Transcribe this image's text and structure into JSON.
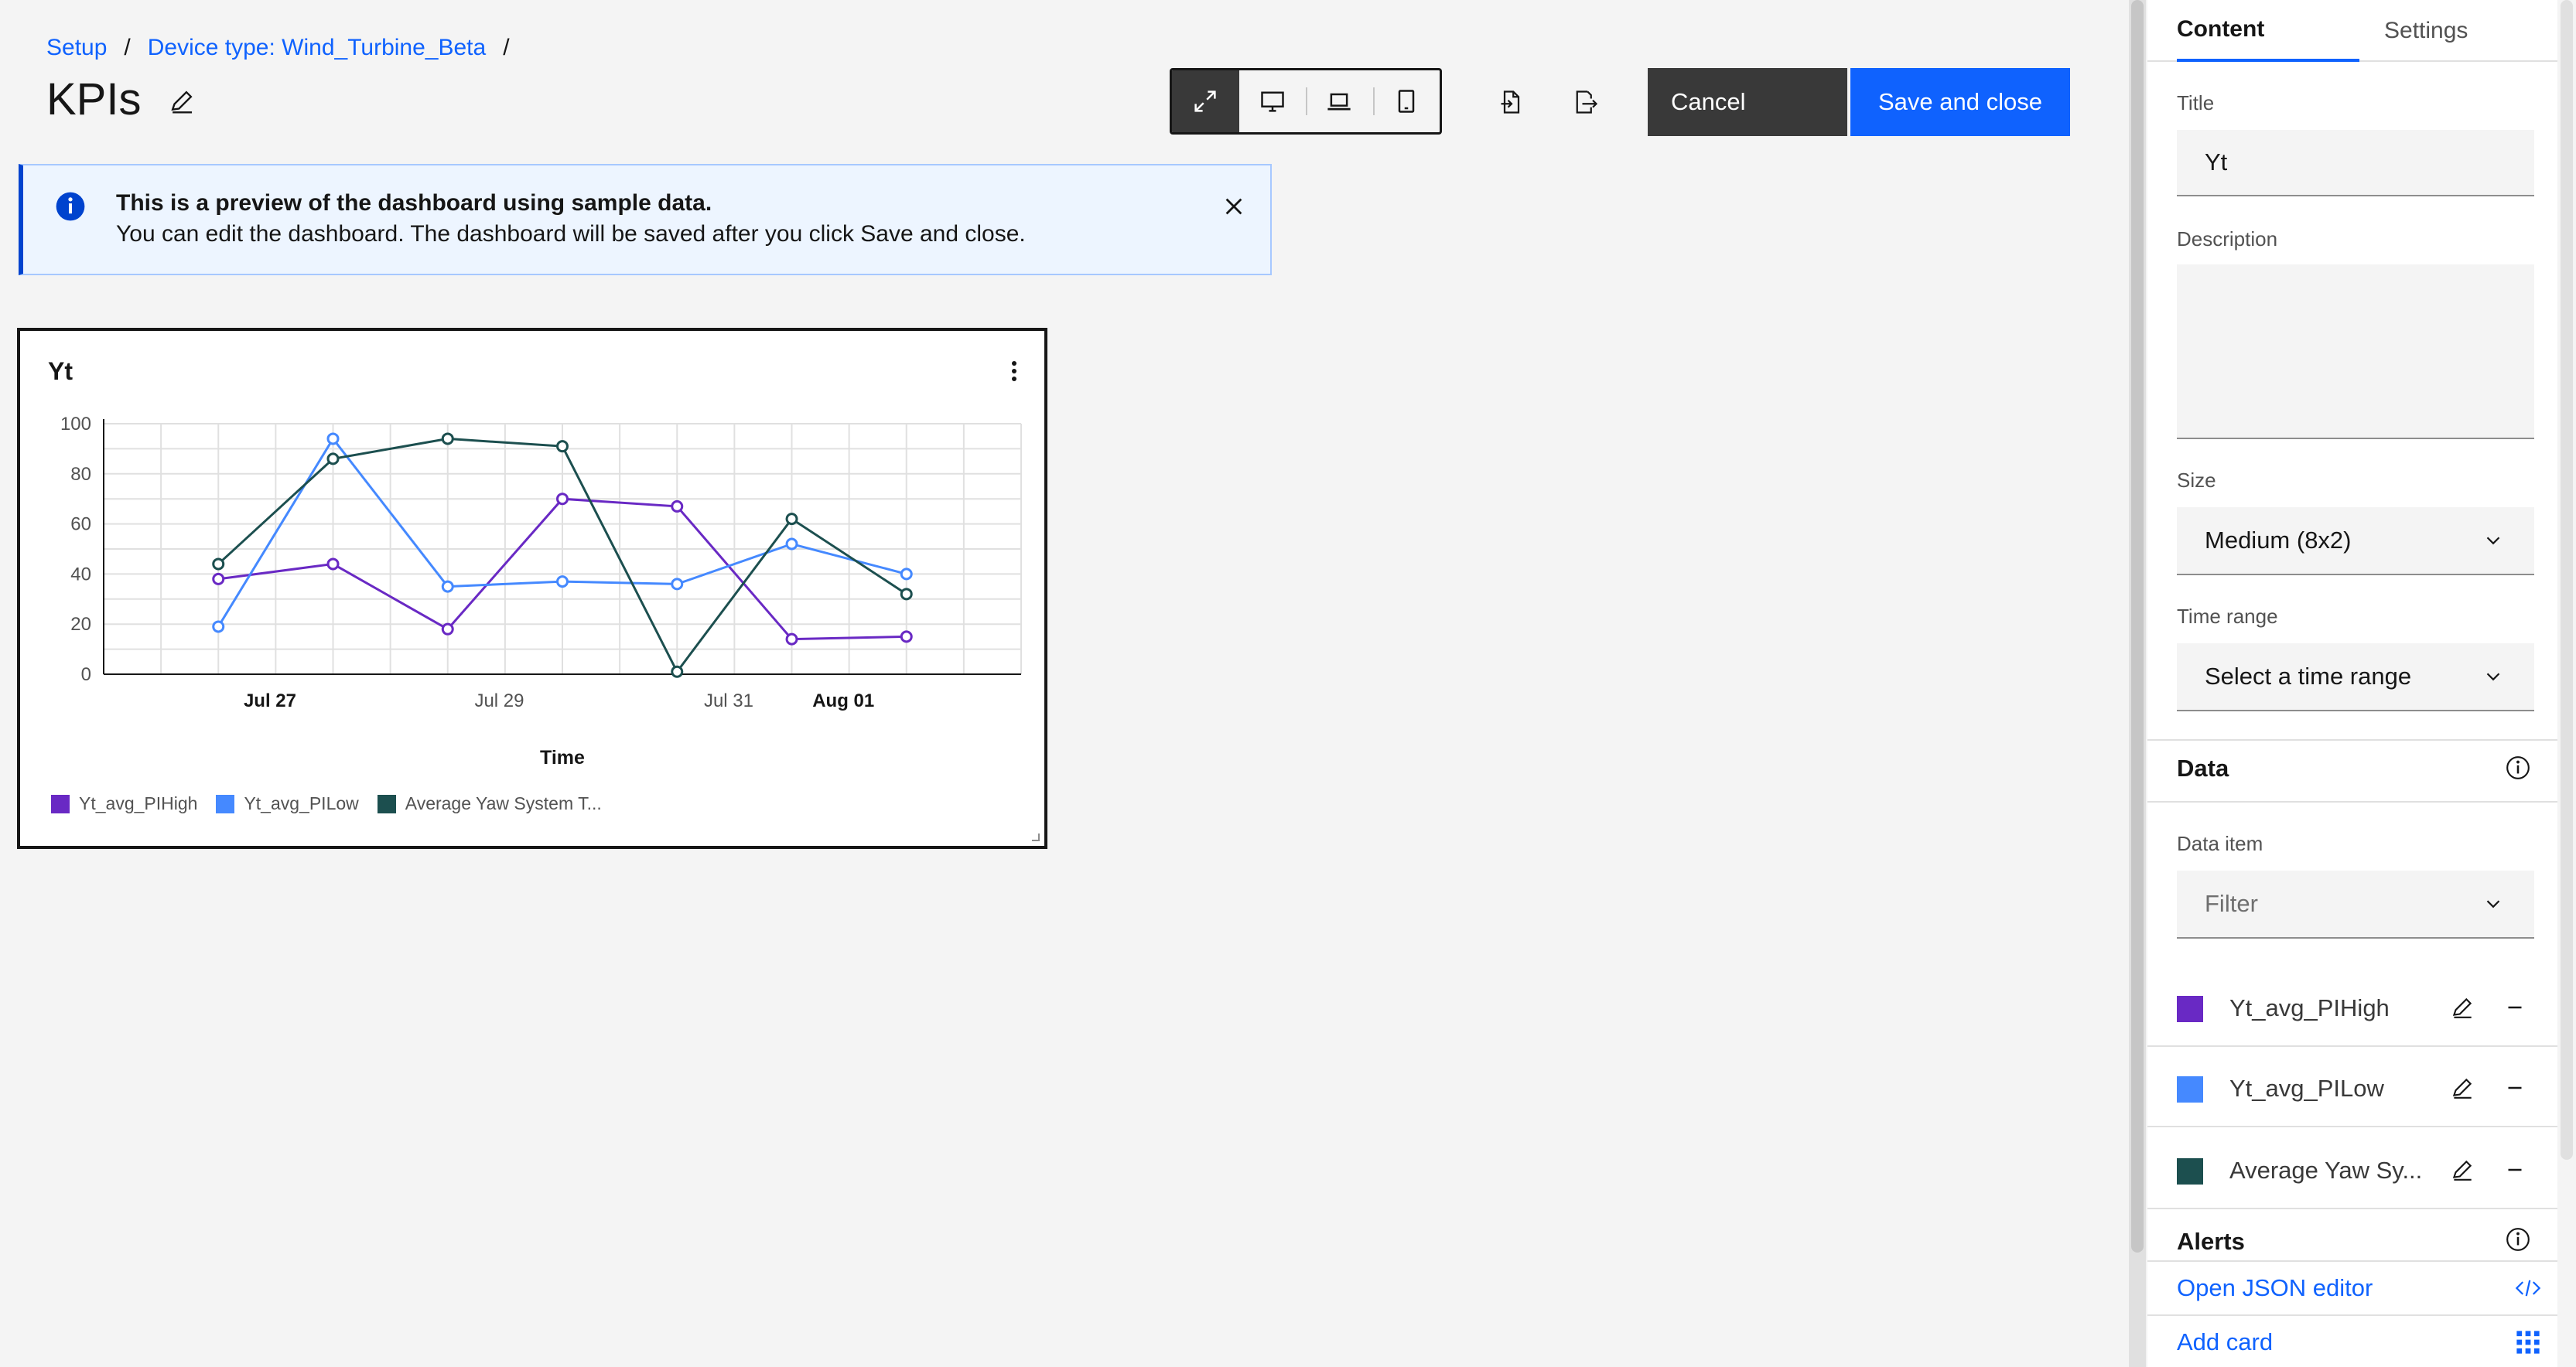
{
  "breadcrumb": {
    "items": [
      "Setup",
      "Device type: Wind_Turbine_Beta"
    ],
    "separator": "/"
  },
  "page": {
    "title": "KPIs"
  },
  "toolbar": {
    "view_modes": [
      "fullscreen-icon",
      "desktop-icon",
      "laptop-icon",
      "tablet-icon"
    ],
    "active_view": "fullscreen-icon",
    "cancel_label": "Cancel",
    "save_label": "Save and close"
  },
  "notification": {
    "title": "This is a preview of the dashboard using sample data.",
    "message": "You can edit the dashboard. The dashboard will be saved after you click Save and close."
  },
  "card": {
    "title": "Yt"
  },
  "chart_data": {
    "type": "line",
    "title": "Yt",
    "xlabel": "Time",
    "ylabel": "",
    "ylim": [
      0,
      100
    ],
    "yticks": [
      0,
      20,
      40,
      60,
      80,
      100
    ],
    "xticks": [
      {
        "label": "Jul 27",
        "x": 0.45,
        "bold": true
      },
      {
        "label": "Jul 29",
        "x": 2.45,
        "bold": false
      },
      {
        "label": "Jul 31",
        "x": 4.45,
        "bold": false
      },
      {
        "label": "Aug 01",
        "x": 5.45,
        "bold": true
      }
    ],
    "xlim": [
      -1,
      7
    ],
    "x": [
      0,
      1,
      2,
      3,
      4,
      5,
      6
    ],
    "grid": true,
    "series": [
      {
        "name": "Yt_avg_PIHigh",
        "color": "#6929c4",
        "values": [
          38,
          44,
          18,
          70,
          67,
          14,
          15
        ]
      },
      {
        "name": "Yt_avg_PILow",
        "color": "#4589ff",
        "values": [
          19,
          94,
          35,
          37,
          36,
          52,
          40
        ]
      },
      {
        "name": "Average Yaw System T...",
        "color": "#1c4f4f",
        "values": [
          44,
          86,
          94,
          91,
          1,
          62,
          32
        ]
      }
    ]
  },
  "panel": {
    "tabs": [
      "Content",
      "Settings"
    ],
    "active_tab": "Content",
    "title_label": "Title",
    "title_value": "Yt",
    "description_label": "Description",
    "description_value": "",
    "size_label": "Size",
    "size_value": "Medium (8x2)",
    "time_range_label": "Time range",
    "time_range_value": "Select a time range",
    "data_section": "Data",
    "data_item_label": "Data item",
    "data_item_placeholder": "Filter",
    "data_items": [
      {
        "name": "Yt_avg_PIHigh",
        "color": "#6929c4"
      },
      {
        "name": "Yt_avg_PILow",
        "color": "#4589ff"
      },
      {
        "name": "Average Yaw Sy...",
        "color": "#1c4f4f"
      }
    ],
    "alerts_section": "Alerts",
    "json_editor_label": "Open JSON editor",
    "add_card_label": "Add card"
  }
}
